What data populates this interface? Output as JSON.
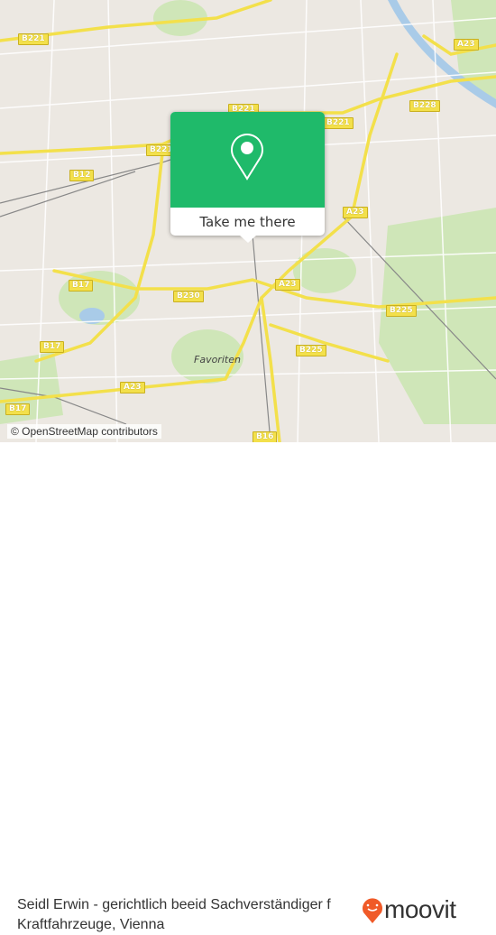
{
  "map": {
    "attribution": "© OpenStreetMap contributors",
    "district_label": "Favoriten",
    "road_shields": [
      "B221",
      "B221",
      "B221",
      "B221",
      "B12",
      "B17",
      "B17",
      "B17",
      "B230",
      "A23",
      "A23",
      "A23",
      "A23",
      "B225",
      "B225",
      "B228",
      "B16"
    ],
    "colors": {
      "background": "#ece8e2",
      "roads": "#f3e04b",
      "parks": "#cfe6b8"
    }
  },
  "popup": {
    "icon": "location-pin-icon",
    "button_label": "Take me there",
    "color": "#1fba6a"
  },
  "footer": {
    "title": "Seidl Erwin - gerichtlich beeid Sachverständiger f Kraftfahrzeuge, Vienna",
    "logo_text": "moovit",
    "logo_color": "#f05a28"
  }
}
